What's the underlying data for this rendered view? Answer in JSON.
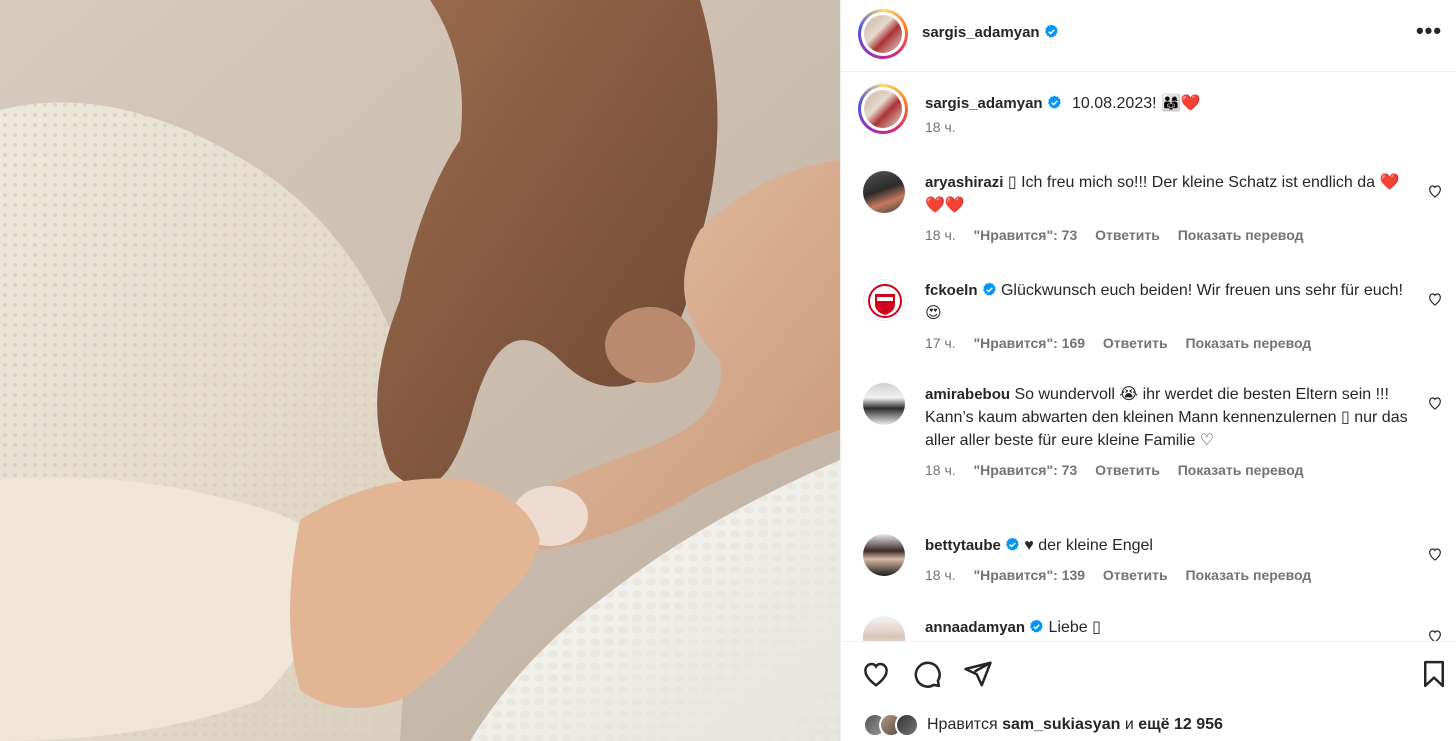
{
  "post": {
    "author": "sargis_adamyan",
    "more_label": "•••"
  },
  "caption": {
    "username": "sargis_adamyan",
    "text": "10.08.2023! 👨‍👩‍👧❤️",
    "time": "18 ч."
  },
  "comments": [
    {
      "username": "aryashirazi",
      "verified": false,
      "text": "▯ Ich freu mich so!!! Der kleine Schatz ist endlich da ❤️❤️❤️",
      "time": "18 ч.",
      "likes": "\"Нравится\": 73",
      "reply": "Ответить",
      "translate": "Показать перевод"
    },
    {
      "username": "fckoeln",
      "verified": true,
      "text": "Glückwunsch euch beiden! Wir freuen uns sehr für euch! 😍",
      "time": "17 ч.",
      "likes": "\"Нравится\": 169",
      "reply": "Ответить",
      "translate": "Показать перевод"
    },
    {
      "username": "amirabebou",
      "verified": false,
      "text": "So wundervoll 😭 ihr werdet die besten Eltern sein !!! Kann’s kaum abwarten den kleinen Mann kennenzulernen ▯ nur das aller aller beste für eure kleine Familie ♡",
      "time": "18 ч.",
      "likes": "\"Нравится\": 73",
      "reply": "Ответить",
      "translate": "Показать перевод"
    },
    {
      "username": "bettytaube",
      "verified": true,
      "text": "♥ der kleine Engel",
      "time": "18 ч.",
      "likes": "\"Нравится\": 139",
      "reply": "Ответить",
      "translate": "Показать перевод"
    },
    {
      "username": "annaadamyan",
      "verified": true,
      "text": "Liebe ▯",
      "time": "",
      "likes": "",
      "reply": "",
      "translate": ""
    }
  ],
  "likes": {
    "prefix": "Нравится",
    "user": "sam_sukiasyan",
    "middle": "и",
    "rest": "ещё 12 956"
  },
  "icons": [
    "heart-icon",
    "comment-icon",
    "share-icon",
    "bookmark-icon",
    "verified-icon",
    "more-icon"
  ],
  "colors": {
    "verified": "#0095f6",
    "text": "#262626",
    "secondary": "#737373"
  }
}
